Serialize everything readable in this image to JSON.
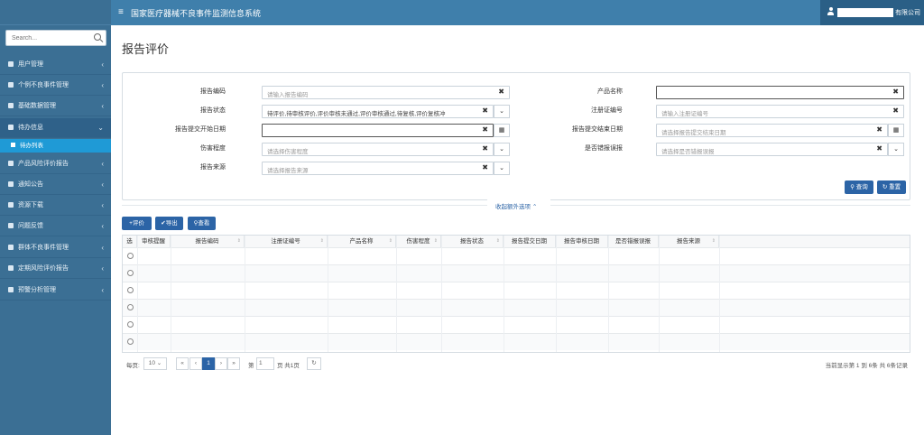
{
  "app": {
    "title": "国家医疗器械不良事件监测信息系统"
  },
  "user": {
    "name": "有限公司"
  },
  "search": {
    "placeholder": "Search..."
  },
  "sidebar": {
    "items": [
      {
        "label": "用户管理",
        "icon": "user-icon"
      },
      {
        "label": "个例不良事件管理",
        "icon": "clipboard-icon"
      },
      {
        "label": "基础数据管理",
        "icon": "table-icon"
      },
      {
        "label": "待办信息",
        "icon": "book-icon",
        "sub": "待办列表"
      },
      {
        "label": "产品风险评价报告",
        "icon": "book-icon"
      },
      {
        "label": "通知公告",
        "icon": "book-icon"
      },
      {
        "label": "资源下载",
        "icon": "book-icon"
      },
      {
        "label": "问题反馈",
        "icon": "book-icon"
      },
      {
        "label": "群体不良事件管理",
        "icon": "book-icon"
      },
      {
        "label": "定期风险评价报告",
        "icon": "book-icon"
      },
      {
        "label": "预警分析管理",
        "icon": "book-icon"
      }
    ]
  },
  "page": {
    "title": "报告评价"
  },
  "filters": {
    "report_code": {
      "label": "报告编码",
      "placeholder": "请输入报告编码"
    },
    "product_name": {
      "label": "产品名称",
      "value": ""
    },
    "report_status": {
      "label": "报告状态",
      "value": "待评价,待审核评价,评价审核未通过,评价审核通过,待复核,评价复核冲"
    },
    "reg_cert_no": {
      "label": "注册证编号",
      "placeholder": "请输入注册证编号"
    },
    "submit_start": {
      "label": "报告提交开始日期",
      "value": ""
    },
    "submit_end": {
      "label": "报告提交结束日期",
      "placeholder": "请选择报告提交结束日期"
    },
    "harm_level": {
      "label": "伤害程度",
      "placeholder": "请选择伤害程度"
    },
    "misreport": {
      "label": "是否错报误报",
      "placeholder": "请选择是否错报误报"
    },
    "report_source": {
      "label": "报告来源",
      "placeholder": "请选择报告来源"
    },
    "query_label": "查询",
    "reset_label": "重置",
    "collapse_label": "收起额外选项"
  },
  "toolbar": {
    "evaluate_label": "评价",
    "export_label": "导出",
    "view_label": "查看"
  },
  "table": {
    "columns": [
      "选",
      "审核提醒",
      "报告编码",
      "注册证编号",
      "产品名称",
      "伤害程度",
      "报告状态",
      "报告提交日期",
      "报告审核日期",
      "是否错报误报",
      "报告来源"
    ],
    "row_count": 6
  },
  "pager": {
    "per_page_label": "每页:",
    "per_page": "10",
    "first": "«",
    "prev": "‹",
    "current": "1",
    "next": "›",
    "last": "»",
    "page_prefix": "第",
    "page_input": "1",
    "page_suffix": "页 共1页",
    "summary": "当前显示第 1 到 6条 共 6条记录"
  }
}
